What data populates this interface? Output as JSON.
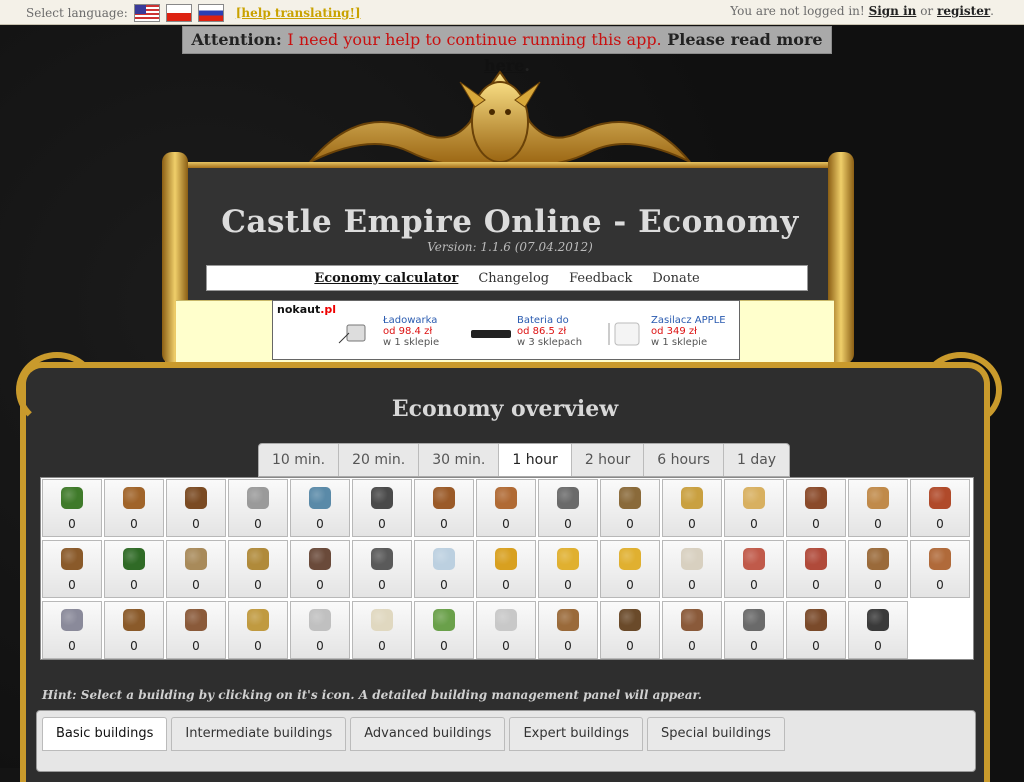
{
  "topbar": {
    "language_label": "Select language:",
    "help_link": "[help translating!]",
    "login_status": "You are not logged in!",
    "sign_in": "Sign in",
    "or": "or",
    "register": "register",
    "period": "."
  },
  "attention": {
    "label": "Attention:",
    "message": "I need your help to continue running this app.",
    "please": "Please read more",
    "link": "here",
    "period": "."
  },
  "header": {
    "title": "Castle Empire Online - Economy",
    "version": "Version: 1.1.6 (07.04.2012)"
  },
  "nav": [
    "Economy calculator",
    "Changelog",
    "Feedback",
    "Donate"
  ],
  "ad": {
    "brand": "nokaut",
    "brand_suffix": ".pl",
    "items": [
      {
        "name": "Ładowarka",
        "price": "od 98.4 zł",
        "stores": "w 1 sklepie"
      },
      {
        "name": "Bateria do",
        "price": "od 86.5 zł",
        "stores": "w 3 sklepach"
      },
      {
        "name": "Zasilacz APPLE",
        "price": "od 349 zł",
        "stores": "w 1 sklepie"
      }
    ]
  },
  "overview": {
    "title": "Economy overview",
    "tabs": [
      "10 min.",
      "20 min.",
      "30 min.",
      "1 hour",
      "2 hour",
      "6 hours",
      "1 day"
    ],
    "active_tab": "1 hour"
  },
  "resources": [
    {
      "icon": "tree-icon",
      "color": "#3f7a2a",
      "value": "0"
    },
    {
      "icon": "log-icon",
      "color": "#a0642a",
      "value": "0"
    },
    {
      "icon": "planks-icon",
      "color": "#7a4a22",
      "value": "0"
    },
    {
      "icon": "stone-icon",
      "color": "#9a9a9a",
      "value": "0"
    },
    {
      "icon": "fish-icon",
      "color": "#5a8aa8",
      "value": "0"
    },
    {
      "icon": "coal-icon",
      "color": "#4a4a4a",
      "value": "0"
    },
    {
      "icon": "copper-ore-icon",
      "color": "#9a5a28",
      "value": "0"
    },
    {
      "icon": "copper-bar-icon",
      "color": "#b06a34",
      "value": "0"
    },
    {
      "icon": "hammer-icon",
      "color": "#6a6a6a",
      "value": "0"
    },
    {
      "icon": "bucket-icon",
      "color": "#8a6a3a",
      "value": "0"
    },
    {
      "icon": "wheat-icon",
      "color": "#c9a040",
      "value": "0"
    },
    {
      "icon": "beer-icon",
      "color": "#d8b060",
      "value": "0"
    },
    {
      "icon": "sausage-icon",
      "color": "#8a4a2a",
      "value": "0"
    },
    {
      "icon": "bread-icon",
      "color": "#c08a4a",
      "value": "0"
    },
    {
      "icon": "sword-icon",
      "color": "#b04a2a",
      "value": "0"
    },
    {
      "icon": "bow-icon",
      "color": "#8a5a2a",
      "value": "0"
    },
    {
      "icon": "tree-icon",
      "color": "#2f6a26",
      "value": "0"
    },
    {
      "icon": "pipe-icon",
      "color": "#a88a5a",
      "value": "0"
    },
    {
      "icon": "planks-icon",
      "color": "#b08a3a",
      "value": "0"
    },
    {
      "icon": "iron-ore-icon",
      "color": "#6a4a3a",
      "value": "0"
    },
    {
      "icon": "iron-bar-icon",
      "color": "#5a5a5a",
      "value": "0"
    },
    {
      "icon": "silver-bar-icon",
      "color": "#bcd0e0",
      "value": "0"
    },
    {
      "icon": "gold-ore-icon",
      "color": "#d8a020",
      "value": "0"
    },
    {
      "icon": "gold-bar-icon",
      "color": "#e0b030",
      "value": "0"
    },
    {
      "icon": "coins-icon",
      "color": "#e0b030",
      "value": "0"
    },
    {
      "icon": "paper-icon",
      "color": "#d8d0c0",
      "value": "0"
    },
    {
      "icon": "ham-icon",
      "color": "#c05a4a",
      "value": "0"
    },
    {
      "icon": "meat-icon",
      "color": "#b04a3a",
      "value": "0"
    },
    {
      "icon": "leather-icon",
      "color": "#9a6a3a",
      "value": "0"
    },
    {
      "icon": "sword-icon",
      "color": "#b06a3a",
      "value": "0"
    },
    {
      "icon": "steel-sword-icon",
      "color": "#8a8a9a",
      "value": "0"
    },
    {
      "icon": "longbow-icon",
      "color": "#8a5a2a",
      "value": "0"
    },
    {
      "icon": "logs-icon",
      "color": "#8a5a3a",
      "value": "0"
    },
    {
      "icon": "boards-icon",
      "color": "#c09a40",
      "value": "0"
    },
    {
      "icon": "flower-icon",
      "color": "#c0c0c0",
      "value": "0"
    },
    {
      "icon": "marble-icon",
      "color": "#e0d8c0",
      "value": "0"
    },
    {
      "icon": "potion-icon",
      "color": "#6aa04a",
      "value": "0"
    },
    {
      "icon": "salt-icon",
      "color": "#c8c8c8",
      "value": "0"
    },
    {
      "icon": "crate-icon",
      "color": "#9a6a3a",
      "value": "0"
    },
    {
      "icon": "wheel-icon",
      "color": "#6a4a2a",
      "value": "0"
    },
    {
      "icon": "cart-icon",
      "color": "#8a5a3a",
      "value": "0"
    },
    {
      "icon": "lance-icon",
      "color": "#6a6a6a",
      "value": "0"
    },
    {
      "icon": "crossbow-icon",
      "color": "#7a4a2a",
      "value": "0"
    },
    {
      "icon": "cannon-icon",
      "color": "#3a3a3a",
      "value": "0"
    }
  ],
  "hint": "Hint: Select a building by clicking on it's icon. A detailed building management panel will appear.",
  "building_tabs": [
    "Basic buildings",
    "Intermediate buildings",
    "Advanced buildings",
    "Expert buildings",
    "Special buildings"
  ],
  "active_building_tab": "Basic buildings",
  "colors": {
    "gold": "#c99a2c",
    "panel": "#2e2e2e",
    "attention_red": "#c81010"
  }
}
